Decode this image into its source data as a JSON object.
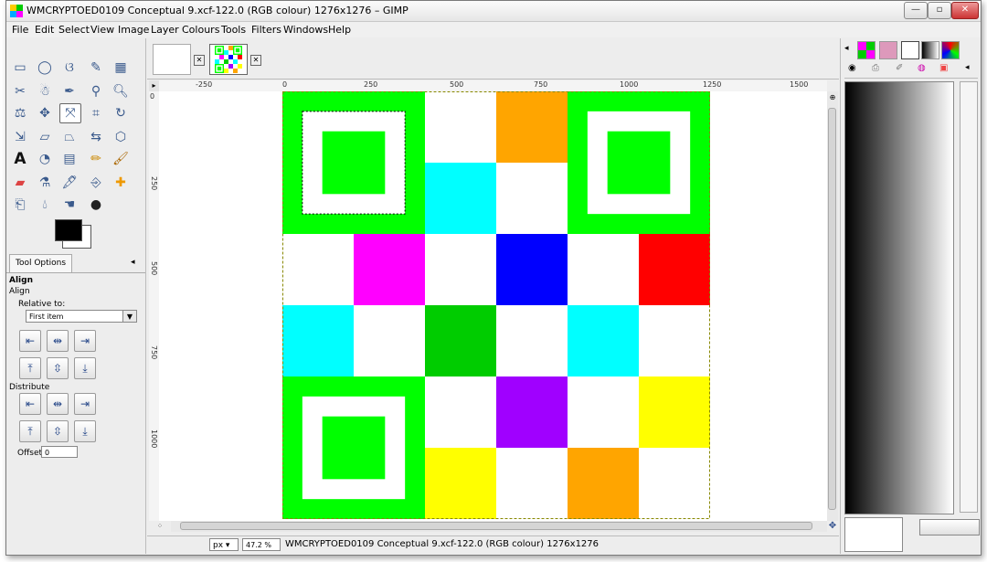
{
  "window": {
    "title": "WMCRYPTOED0109 Conceptual 9.xcf-122.0 (RGB colour) 1276x1276 – GIMP",
    "min_glyph": "—",
    "max_glyph": "▫",
    "close_glyph": "✕"
  },
  "menu": {
    "items": [
      "File",
      "Edit",
      "Select",
      "View",
      "Image",
      "Layer",
      "Colours",
      "Tools",
      "Filters",
      "Windows",
      "Help"
    ]
  },
  "tool_options": {
    "tab_label": "Tool Options",
    "heading": "Align",
    "subheading": "Align",
    "relative_label": "Relative to:",
    "relative_value": "First item",
    "distribute_label": "Distribute",
    "offset_label": "Offset:",
    "offset_value": "0"
  },
  "rulers": {
    "horizontal_ticks": [
      "-250",
      "0",
      "250",
      "500",
      "750",
      "1000",
      "1250",
      "1500"
    ],
    "vertical_ticks": [
      "0",
      "250",
      "500",
      "750",
      "1000"
    ]
  },
  "status": {
    "unit": "px",
    "zoom": "47.2 %",
    "text": "WMCRYPTOED0109 Conceptual 9.xcf-122.0 (RGB colour) 1276x1276"
  },
  "image": {
    "grid_size": 6,
    "cells": [
      [
        "finder",
        "finder",
        "#ffffff",
        "#ffa500",
        "finder",
        "finder"
      ],
      [
        "finder",
        "finder",
        "#00ffff",
        "#ffffff",
        "finder",
        "finder"
      ],
      [
        "#ffffff",
        "#ff00ff",
        "#ffffff",
        "#0000ff",
        "#ffffff",
        "#ff0000"
      ],
      [
        "#00ffff",
        "#ffffff",
        "#00cc00",
        "#ffffff",
        "#00ffff",
        "#ffffff"
      ],
      [
        "finder",
        "finder",
        "#ffffff",
        "#a000ff",
        "#ffffff",
        "#ffff00"
      ],
      [
        "finder",
        "finder",
        "#ffff00",
        "#ffffff",
        "#ffa500",
        "#ffffff"
      ]
    ],
    "finder_color": "#00ff00"
  },
  "colors": {
    "accent": "#00ff00"
  }
}
